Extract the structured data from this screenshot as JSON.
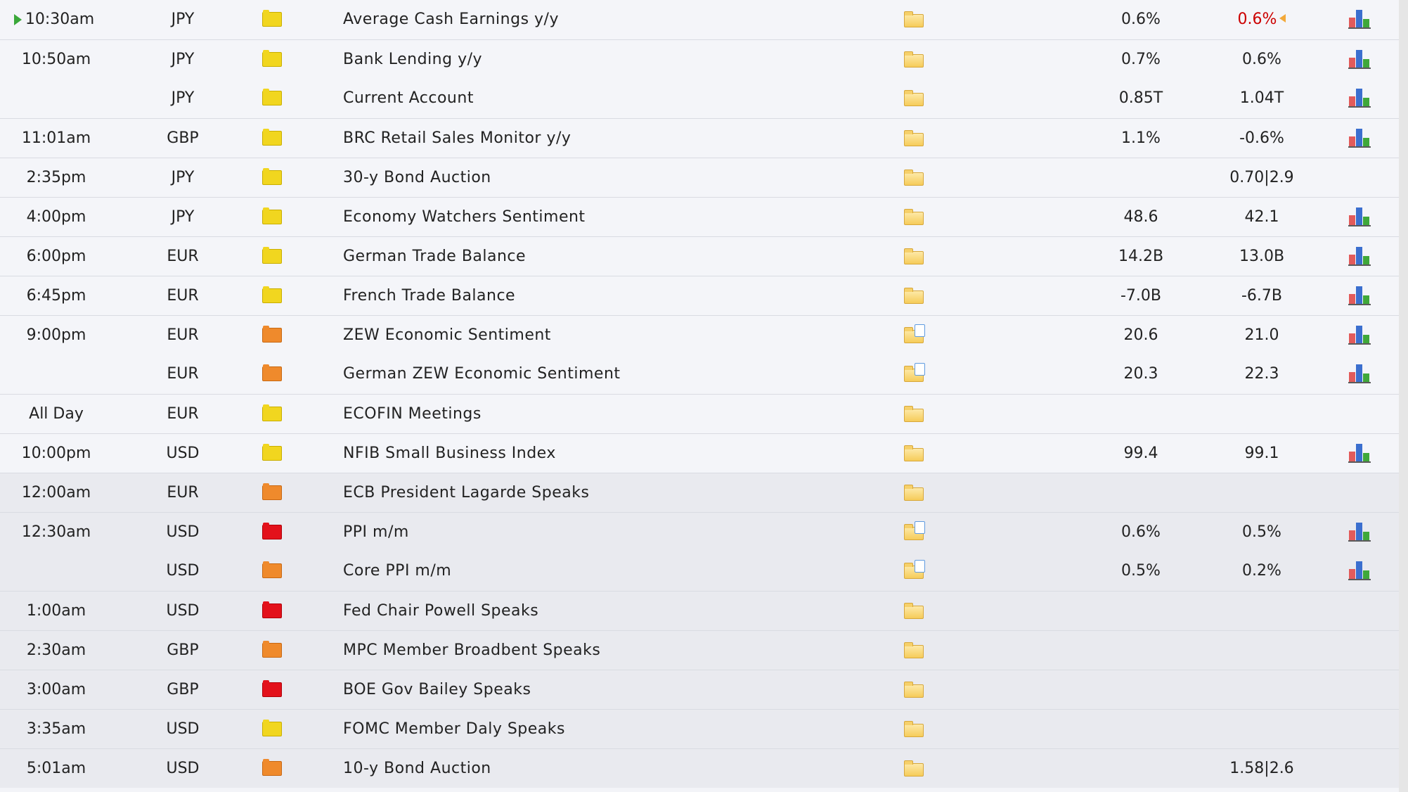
{
  "rows": [
    {
      "time": "10:30am",
      "currency": "JPY",
      "impact": "low",
      "event": "Average Cash Earnings y/y",
      "doc": false,
      "actual": "0.6%",
      "previous": "0.6%",
      "revised": true,
      "chart": true,
      "current": true,
      "sep": false,
      "alt": false
    },
    {
      "time": "10:50am",
      "currency": "JPY",
      "impact": "low",
      "event": "Bank Lending y/y",
      "doc": false,
      "actual": "0.7%",
      "previous": "0.6%",
      "chart": true,
      "sep": true,
      "alt": false
    },
    {
      "time": "",
      "currency": "JPY",
      "impact": "low",
      "event": "Current Account",
      "doc": false,
      "actual": "0.85T",
      "previous": "1.04T",
      "chart": true,
      "sep": false,
      "alt": false
    },
    {
      "time": "11:01am",
      "currency": "GBP",
      "impact": "low",
      "event": "BRC Retail Sales Monitor y/y",
      "doc": false,
      "actual": "1.1%",
      "previous": "-0.6%",
      "chart": true,
      "sep": true,
      "alt": false
    },
    {
      "time": "2:35pm",
      "currency": "JPY",
      "impact": "low",
      "event": "30-y Bond Auction",
      "doc": false,
      "actual": "",
      "previous": "0.70|2.9",
      "chart": false,
      "sep": true,
      "alt": false
    },
    {
      "time": "4:00pm",
      "currency": "JPY",
      "impact": "low",
      "event": "Economy Watchers Sentiment",
      "doc": false,
      "actual": "48.6",
      "previous": "42.1",
      "chart": true,
      "sep": true,
      "alt": false
    },
    {
      "time": "6:00pm",
      "currency": "EUR",
      "impact": "low",
      "event": "German Trade Balance",
      "doc": false,
      "actual": "14.2B",
      "previous": "13.0B",
      "chart": true,
      "sep": true,
      "alt": false
    },
    {
      "time": "6:45pm",
      "currency": "EUR",
      "impact": "low",
      "event": "French Trade Balance",
      "doc": false,
      "actual": "-7.0B",
      "previous": "-6.7B",
      "chart": true,
      "sep": true,
      "alt": false
    },
    {
      "time": "9:00pm",
      "currency": "EUR",
      "impact": "med",
      "event": "ZEW Economic Sentiment",
      "doc": true,
      "actual": "20.6",
      "previous": "21.0",
      "chart": true,
      "sep": true,
      "alt": false
    },
    {
      "time": "",
      "currency": "EUR",
      "impact": "med",
      "event": "German ZEW Economic Sentiment",
      "doc": true,
      "actual": "20.3",
      "previous": "22.3",
      "chart": true,
      "sep": false,
      "alt": false
    },
    {
      "time": "All Day",
      "currency": "EUR",
      "impact": "low",
      "event": "ECOFIN Meetings",
      "doc": false,
      "actual": "",
      "previous": "",
      "chart": false,
      "sep": true,
      "alt": false
    },
    {
      "time": "10:00pm",
      "currency": "USD",
      "impact": "low",
      "event": "NFIB Small Business Index",
      "doc": false,
      "actual": "99.4",
      "previous": "99.1",
      "chart": true,
      "sep": true,
      "alt": false
    },
    {
      "time": "12:00am",
      "currency": "EUR",
      "impact": "med",
      "event": "ECB President Lagarde Speaks",
      "doc": false,
      "actual": "",
      "previous": "",
      "chart": false,
      "sep": true,
      "alt": true
    },
    {
      "time": "12:30am",
      "currency": "USD",
      "impact": "high",
      "event": "PPI m/m",
      "doc": true,
      "actual": "0.6%",
      "previous": "0.5%",
      "chart": true,
      "sep": true,
      "alt": true
    },
    {
      "time": "",
      "currency": "USD",
      "impact": "med",
      "event": "Core PPI m/m",
      "doc": true,
      "actual": "0.5%",
      "previous": "0.2%",
      "chart": true,
      "sep": false,
      "alt": true
    },
    {
      "time": "1:00am",
      "currency": "USD",
      "impact": "high",
      "event": "Fed Chair Powell Speaks",
      "doc": false,
      "actual": "",
      "previous": "",
      "chart": false,
      "sep": true,
      "alt": true
    },
    {
      "time": "2:30am",
      "currency": "GBP",
      "impact": "med",
      "event": "MPC Member Broadbent Speaks",
      "doc": false,
      "actual": "",
      "previous": "",
      "chart": false,
      "sep": true,
      "alt": true
    },
    {
      "time": "3:00am",
      "currency": "GBP",
      "impact": "high",
      "event": "BOE Gov Bailey Speaks",
      "doc": false,
      "actual": "",
      "previous": "",
      "chart": false,
      "sep": true,
      "alt": true
    },
    {
      "time": "3:35am",
      "currency": "USD",
      "impact": "low",
      "event": "FOMC Member Daly Speaks",
      "doc": false,
      "actual": "",
      "previous": "",
      "chart": false,
      "sep": true,
      "alt": true
    },
    {
      "time": "5:01am",
      "currency": "USD",
      "impact": "med",
      "event": "10-y Bond Auction",
      "doc": false,
      "actual": "",
      "previous": "1.58|2.6",
      "chart": false,
      "sep": true,
      "alt": true
    }
  ]
}
